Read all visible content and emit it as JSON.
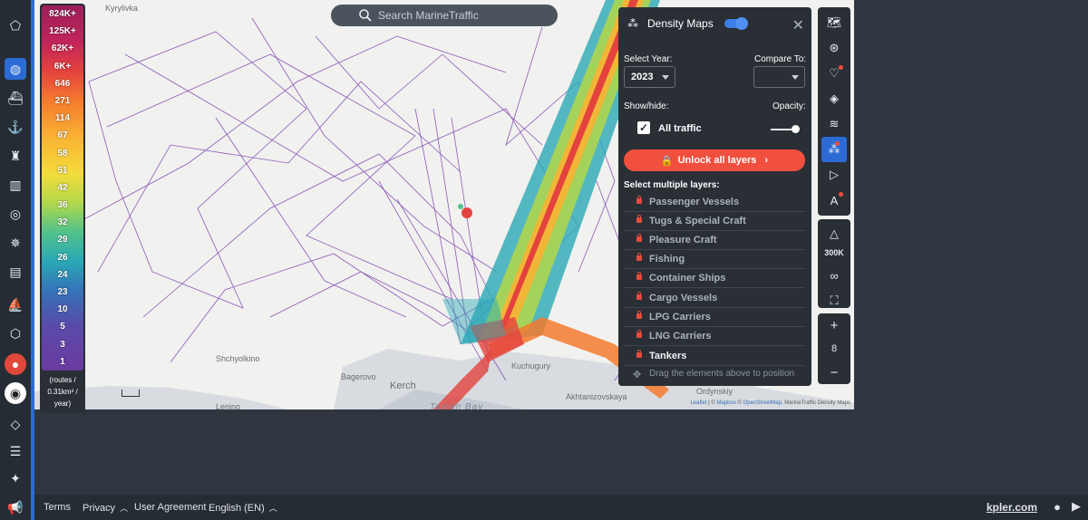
{
  "search": {
    "placeholder": "Search MarineTraffic"
  },
  "legend": {
    "ticks": [
      "824K+",
      "125K+",
      "62K+",
      "6K+",
      "646",
      "271",
      "114",
      "67",
      "58",
      "51",
      "42",
      "36",
      "32",
      "29",
      "26",
      "24",
      "23",
      "10",
      "5",
      "3",
      "1"
    ],
    "unit_lines": [
      "(routes /",
      "0.31km² /",
      "year)"
    ]
  },
  "map": {
    "places": [
      "Kyrylivka",
      "Shchyolkino",
      "Bagerovo",
      "Kerch",
      "Kuchugury",
      "Akhtanizovskaya",
      "Ordynskiy",
      "Lenino",
      "Taman Bay"
    ]
  },
  "panel": {
    "title": "Density Maps",
    "select_year_label": "Select Year:",
    "year_value": "2023",
    "compare_label": "Compare To:",
    "compare_value": "",
    "show_hide_label": "Show/hide:",
    "opacity_label": "Opacity:",
    "all_traffic_label": "All traffic",
    "unlock_label": "Unlock all layers",
    "select_multiple_label": "Select multiple layers:",
    "layers": [
      "Passenger Vessels",
      "Tugs & Special Craft",
      "Pleasure Craft",
      "Fishing",
      "Container Ships",
      "Cargo Vessels",
      "LPG Carriers",
      "LNG Carriers",
      "Tankers"
    ],
    "drag_hint": "Drag the elements above to position"
  },
  "toolbar": {
    "scale_label": "300K",
    "zoom_level": "8"
  },
  "attribution": {
    "leaflet": "Leaflet",
    "mapbox": "Mapbox",
    "osm": "OpenStreetMap",
    "mt": "MarineTraffic Density Maps"
  },
  "bottom": {
    "terms": "Terms",
    "privacy": "Privacy",
    "agreement": "User Agreement",
    "language": "English (EN)",
    "kpler": "kpler.com"
  },
  "colors": {
    "accent": "#2c6bd6",
    "unlock": "#f1503f",
    "route": "#7b3fb0"
  }
}
